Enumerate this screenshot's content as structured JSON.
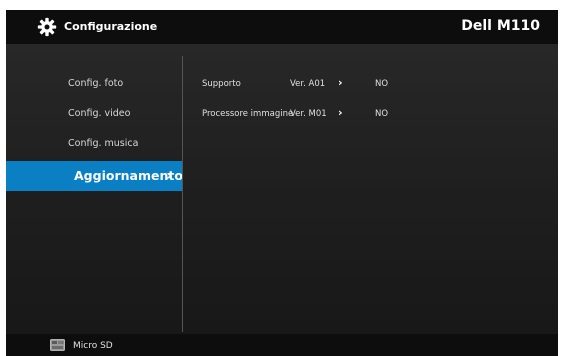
{
  "header": {
    "gear_icon": "gear-icon",
    "title": "Configurazione",
    "device": "Dell M110"
  },
  "sidebar": {
    "items": [
      {
        "label": "Config. foto"
      },
      {
        "label": "Config. video"
      },
      {
        "label": "Config. musica"
      },
      {
        "label": "Aggiornamento",
        "arrow": "›"
      }
    ],
    "active_color": "#0b7fc4"
  },
  "main": {
    "rows": [
      {
        "label": "Supporto",
        "version": "Ver. A01",
        "chevron": "›",
        "value": "NO"
      },
      {
        "label": "Processore immagine",
        "version": "Ver. M01",
        "chevron": "›",
        "value": "NO"
      }
    ]
  },
  "footer": {
    "source_icon": "microsd-icon",
    "source_label": "Micro SD"
  }
}
